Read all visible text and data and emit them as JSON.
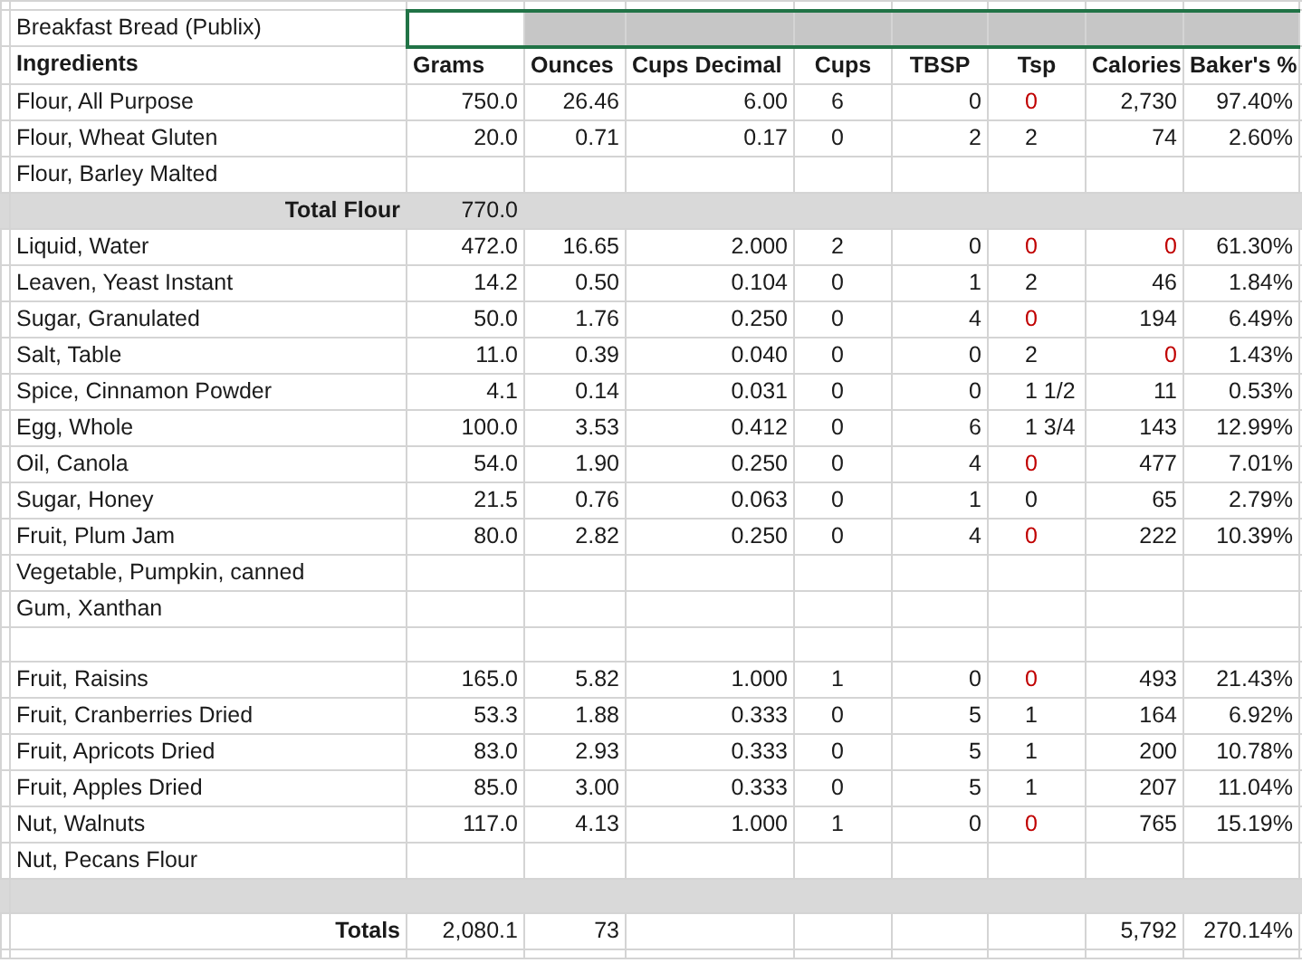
{
  "sheet": {
    "title": "Breakfast Bread (Publix)",
    "title_range_selected": true
  },
  "columns": [
    "Ingredients",
    "Grams",
    "Ounces",
    "Cups Decimal",
    "Cups",
    "TBSP",
    "Tsp",
    "Calories",
    "Baker's %"
  ],
  "rows": [
    {
      "kind": "ingredient",
      "name": "Flour, All Purpose",
      "grams": "750.0",
      "ounces": "26.46",
      "cups_decimal": "6.00",
      "cups": "6",
      "tbsp": "0",
      "tsp": {
        "text": "0",
        "flagged": true
      },
      "calories": {
        "text": "2,730",
        "flagged": false
      },
      "bakers_pct": "97.40%"
    },
    {
      "kind": "ingredient",
      "name": "Flour, Wheat Gluten",
      "grams": "20.0",
      "ounces": "0.71",
      "cups_decimal": "0.17",
      "cups": "0",
      "tbsp": "2",
      "tsp": {
        "text": "2",
        "flagged": false
      },
      "calories": {
        "text": "74",
        "flagged": false
      },
      "bakers_pct": "2.60%"
    },
    {
      "kind": "ingredient",
      "name": "Flour, Barley Malted"
    },
    {
      "kind": "subtotal",
      "label": "Total Flour",
      "grams": "770.0"
    },
    {
      "kind": "ingredient",
      "name": "Liquid, Water",
      "grams": "472.0",
      "ounces": "16.65",
      "cups_decimal": "2.000",
      "cups": "2",
      "tbsp": "0",
      "tsp": {
        "text": "0",
        "flagged": true
      },
      "calories": {
        "text": "0",
        "flagged": true
      },
      "bakers_pct": "61.30%"
    },
    {
      "kind": "ingredient",
      "name": "Leaven, Yeast Instant",
      "grams": "14.2",
      "ounces": "0.50",
      "cups_decimal": "0.104",
      "cups": "0",
      "tbsp": "1",
      "tsp": {
        "text": "2",
        "flagged": false
      },
      "calories": {
        "text": "46",
        "flagged": false
      },
      "bakers_pct": "1.84%"
    },
    {
      "kind": "ingredient",
      "name": "Sugar, Granulated",
      "grams": "50.0",
      "ounces": "1.76",
      "cups_decimal": "0.250",
      "cups": "0",
      "tbsp": "4",
      "tsp": {
        "text": "0",
        "flagged": true
      },
      "calories": {
        "text": "194",
        "flagged": false
      },
      "bakers_pct": "6.49%"
    },
    {
      "kind": "ingredient",
      "name": "Salt, Table",
      "grams": "11.0",
      "ounces": "0.39",
      "cups_decimal": "0.040",
      "cups": "0",
      "tbsp": "0",
      "tsp": {
        "text": "2",
        "flagged": false
      },
      "calories": {
        "text": "0",
        "flagged": true
      },
      "bakers_pct": "1.43%"
    },
    {
      "kind": "ingredient",
      "name": "Spice, Cinnamon Powder",
      "grams": "4.1",
      "ounces": "0.14",
      "cups_decimal": "0.031",
      "cups": "0",
      "tbsp": "0",
      "tsp": {
        "text": "1 1/2",
        "flagged": false
      },
      "calories": {
        "text": "11",
        "flagged": false
      },
      "bakers_pct": "0.53%"
    },
    {
      "kind": "ingredient",
      "name": "Egg, Whole",
      "grams": "100.0",
      "ounces": "3.53",
      "cups_decimal": "0.412",
      "cups": "0",
      "tbsp": "6",
      "tsp": {
        "text": "1 3/4",
        "flagged": false
      },
      "calories": {
        "text": "143",
        "flagged": false
      },
      "bakers_pct": "12.99%"
    },
    {
      "kind": "ingredient",
      "name": "Oil, Canola",
      "grams": "54.0",
      "ounces": "1.90",
      "cups_decimal": "0.250",
      "cups": "0",
      "tbsp": "4",
      "tsp": {
        "text": "0",
        "flagged": true
      },
      "calories": {
        "text": "477",
        "flagged": false
      },
      "bakers_pct": "7.01%"
    },
    {
      "kind": "ingredient",
      "name": "Sugar, Honey",
      "grams": "21.5",
      "ounces": "0.76",
      "cups_decimal": "0.063",
      "cups": "0",
      "tbsp": "1",
      "tsp": {
        "text": "0",
        "flagged": false
      },
      "calories": {
        "text": "65",
        "flagged": false
      },
      "bakers_pct": "2.79%"
    },
    {
      "kind": "ingredient",
      "name": "Fruit, Plum Jam",
      "grams": "80.0",
      "ounces": "2.82",
      "cups_decimal": "0.250",
      "cups": "0",
      "tbsp": "4",
      "tsp": {
        "text": "0",
        "flagged": true
      },
      "calories": {
        "text": "222",
        "flagged": false
      },
      "bakers_pct": "10.39%"
    },
    {
      "kind": "ingredient",
      "name": "Vegetable, Pumpkin, canned"
    },
    {
      "kind": "ingredient",
      "name": "Gum, Xanthan"
    },
    {
      "kind": "blank"
    },
    {
      "kind": "ingredient",
      "name": "Fruit, Raisins",
      "grams": "165.0",
      "ounces": "5.82",
      "cups_decimal": "1.000",
      "cups": "1",
      "tbsp": "0",
      "tsp": {
        "text": "0",
        "flagged": true
      },
      "calories": {
        "text": "493",
        "flagged": false
      },
      "bakers_pct": "21.43%"
    },
    {
      "kind": "ingredient",
      "name": "Fruit, Cranberries Dried",
      "grams": "53.3",
      "ounces": "1.88",
      "cups_decimal": "0.333",
      "cups": "0",
      "tbsp": "5",
      "tsp": {
        "text": "1",
        "flagged": false
      },
      "calories": {
        "text": "164",
        "flagged": false
      },
      "bakers_pct": "6.92%"
    },
    {
      "kind": "ingredient",
      "name": "Fruit, Apricots Dried",
      "grams": "83.0",
      "ounces": "2.93",
      "cups_decimal": "0.333",
      "cups": "0",
      "tbsp": "5",
      "tsp": {
        "text": "1",
        "flagged": false
      },
      "calories": {
        "text": "200",
        "flagged": false
      },
      "bakers_pct": "10.78%"
    },
    {
      "kind": "ingredient",
      "name": "Fruit, Apples Dried",
      "grams": "85.0",
      "ounces": "3.00",
      "cups_decimal": "0.333",
      "cups": "0",
      "tbsp": "5",
      "tsp": {
        "text": "1",
        "flagged": false
      },
      "calories": {
        "text": "207",
        "flagged": false
      },
      "bakers_pct": "11.04%"
    },
    {
      "kind": "ingredient",
      "name": "Nut, Walnuts",
      "grams": "117.0",
      "ounces": "4.13",
      "cups_decimal": "1.000",
      "cups": "1",
      "tbsp": "0",
      "tsp": {
        "text": "0",
        "flagged": true
      },
      "calories": {
        "text": "765",
        "flagged": false
      },
      "bakers_pct": "15.19%"
    },
    {
      "kind": "ingredient",
      "name": "Nut, Pecans Flour"
    },
    {
      "kind": "divider"
    },
    {
      "kind": "total",
      "label": "Totals",
      "grams": "2,080.1",
      "ounces": "73",
      "calories": {
        "text": "5,792",
        "flagged": false
      },
      "bakers_pct": "270.14%"
    }
  ]
}
